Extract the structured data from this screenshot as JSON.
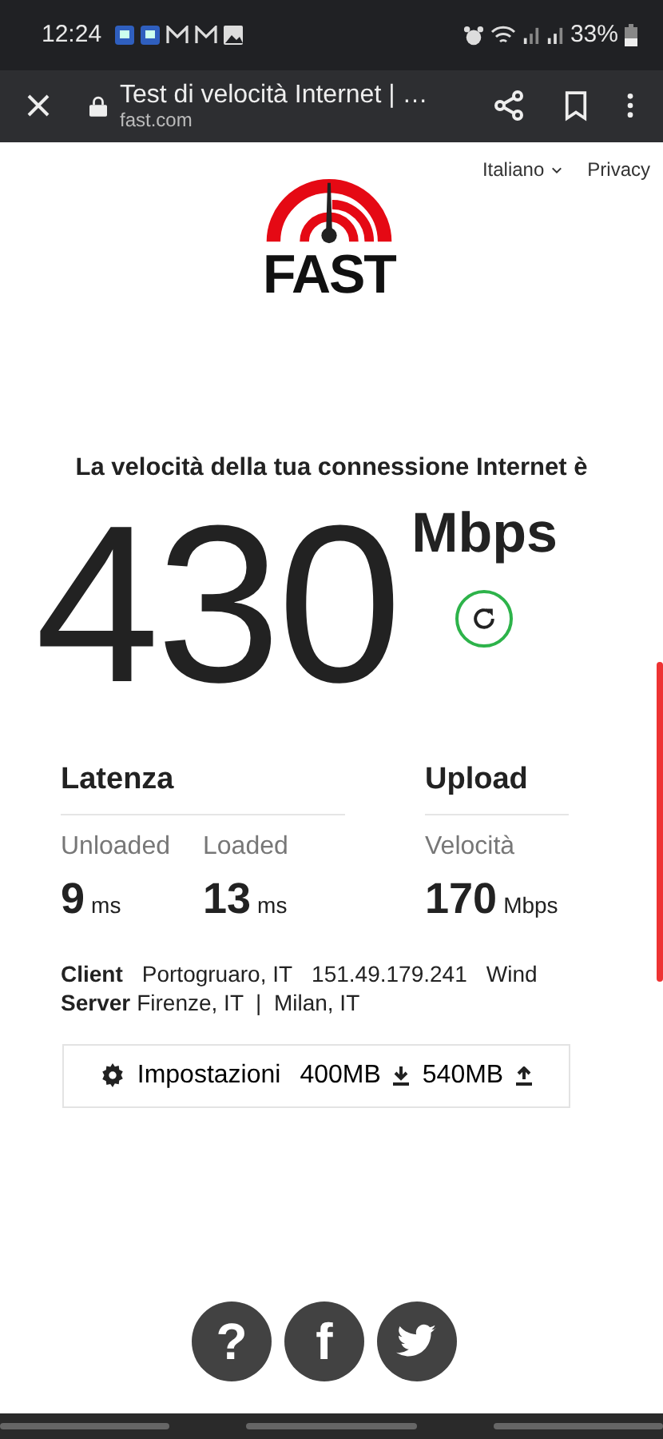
{
  "status_bar": {
    "time": "12:24",
    "battery": "33%"
  },
  "browser": {
    "title": "Test di velocità Internet | …",
    "url": "fast.com"
  },
  "nav": {
    "language": "Italiano",
    "privacy": "Privacy"
  },
  "logo": {
    "text": "FAST"
  },
  "headline": "La velocità della tua connessione Internet è",
  "speed": {
    "value": "430",
    "unit": "Mbps"
  },
  "latency": {
    "title": "Latenza",
    "items": [
      {
        "label": "Unloaded",
        "value": "9",
        "unit": "ms"
      },
      {
        "label": "Loaded",
        "value": "13",
        "unit": "ms"
      }
    ]
  },
  "upload": {
    "title": "Upload",
    "items": [
      {
        "label": "Velocità",
        "value": "170",
        "unit": "Mbps"
      }
    ]
  },
  "client": {
    "label": "Client",
    "location": "Portogruaro, IT",
    "ip": "151.49.179.241",
    "isp": "Wind"
  },
  "server": {
    "label": "Server",
    "text": "Firenze, IT  |  Milan, IT"
  },
  "settings": {
    "label": "Impostazioni",
    "download": "400MB",
    "upload": "540MB"
  },
  "footer": {
    "help": "?",
    "facebook": "f"
  }
}
